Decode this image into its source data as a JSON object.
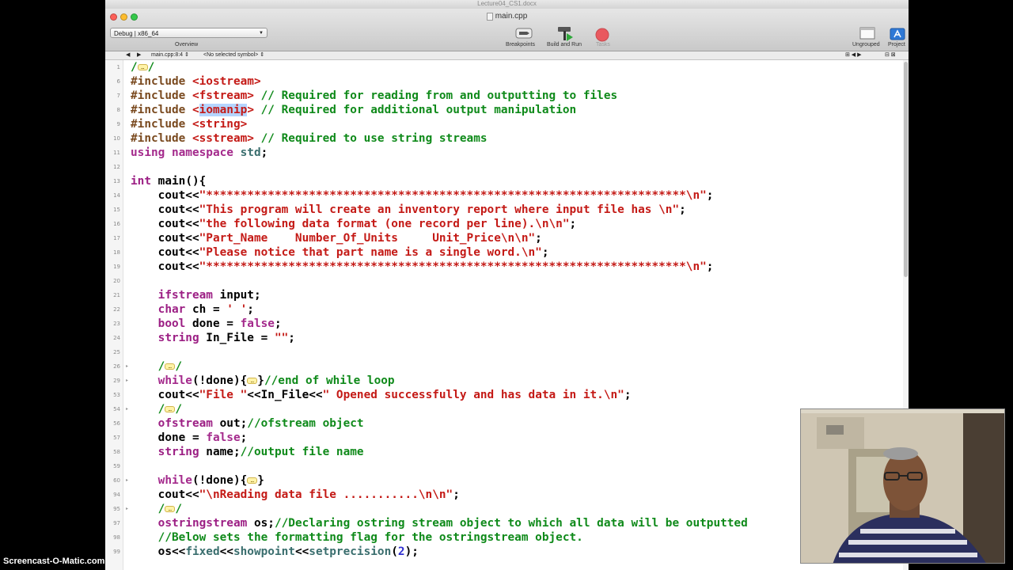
{
  "window": {
    "doc_title": "Lecture04_CS1.docx",
    "file_title": "main.cpp"
  },
  "toolbar": {
    "scheme": "Debug | x86_64",
    "overview": "Overview",
    "breakpoints": "Breakpoints",
    "build_and_run": "Build and Run",
    "tasks": "Tasks",
    "ungrouped": "Ungrouped",
    "project": "Project"
  },
  "jumpbar": {
    "back": "◀",
    "forward": "▶",
    "file": "main.cpp:8:4 ⇕",
    "symbol": "<No selected symbol> ⇕"
  },
  "code": {
    "lines": [
      {
        "n": "1",
        "fold": "",
        "segs": [
          {
            "t": "/",
            "c": "cm"
          },
          {
            "t": "…",
            "c": "fb"
          },
          {
            "t": "/",
            "c": "cm"
          }
        ]
      },
      {
        "n": "6",
        "fold": "",
        "segs": [
          {
            "t": "#include ",
            "c": "pp"
          },
          {
            "t": "<iostream>",
            "c": "str"
          }
        ]
      },
      {
        "n": "7",
        "fold": "",
        "segs": [
          {
            "t": "#include ",
            "c": "pp"
          },
          {
            "t": "<fstream>",
            "c": "str"
          },
          {
            "t": " // Required for reading from and outputting to files",
            "c": "cm"
          }
        ]
      },
      {
        "n": "8",
        "fold": "",
        "segs": [
          {
            "t": "#include ",
            "c": "pp"
          },
          {
            "t": "<",
            "c": "str"
          },
          {
            "t": "iomanip",
            "c": "str hl"
          },
          {
            "t": ">",
            "c": "str"
          },
          {
            "t": " // Required for additional output manipulation",
            "c": "cm"
          }
        ]
      },
      {
        "n": "9",
        "fold": "",
        "segs": [
          {
            "t": "#include ",
            "c": "pp"
          },
          {
            "t": "<string>",
            "c": "str"
          }
        ]
      },
      {
        "n": "10",
        "fold": "",
        "segs": [
          {
            "t": "#include ",
            "c": "pp"
          },
          {
            "t": "<sstream>",
            "c": "str"
          },
          {
            "t": " // Required to use string streams",
            "c": "cm"
          }
        ]
      },
      {
        "n": "11",
        "fold": "",
        "segs": [
          {
            "t": "using namespace ",
            "c": "kw"
          },
          {
            "t": "std",
            "c": "lib"
          },
          {
            "t": ";",
            "c": ""
          }
        ]
      },
      {
        "n": "12",
        "fold": "",
        "segs": []
      },
      {
        "n": "13",
        "fold": "",
        "segs": [
          {
            "t": "int",
            "c": "ty"
          },
          {
            "t": " main(){",
            "c": ""
          }
        ]
      },
      {
        "n": "14",
        "fold": "",
        "segs": [
          {
            "t": "    cout<<",
            "c": ""
          },
          {
            "t": "\"**********************************************************************\\n\"",
            "c": "str"
          },
          {
            "t": ";",
            "c": ""
          }
        ]
      },
      {
        "n": "15",
        "fold": "",
        "segs": [
          {
            "t": "    cout<<",
            "c": ""
          },
          {
            "t": "\"This program will create an inventory report where input file has \\n\"",
            "c": "str"
          },
          {
            "t": ";",
            "c": ""
          }
        ]
      },
      {
        "n": "16",
        "fold": "",
        "segs": [
          {
            "t": "    cout<<",
            "c": ""
          },
          {
            "t": "\"the following data format (one record per line).\\n\\n\"",
            "c": "str"
          },
          {
            "t": ";",
            "c": ""
          }
        ]
      },
      {
        "n": "17",
        "fold": "",
        "segs": [
          {
            "t": "    cout<<",
            "c": ""
          },
          {
            "t": "\"Part_Name    Number_Of_Units     Unit_Price\\n\\n\"",
            "c": "str"
          },
          {
            "t": ";",
            "c": ""
          }
        ]
      },
      {
        "n": "18",
        "fold": "",
        "segs": [
          {
            "t": "    cout<<",
            "c": ""
          },
          {
            "t": "\"Please notice that part name is a single word.\\n\"",
            "c": "str"
          },
          {
            "t": ";",
            "c": ""
          }
        ]
      },
      {
        "n": "19",
        "fold": "",
        "segs": [
          {
            "t": "    cout<<",
            "c": ""
          },
          {
            "t": "\"**********************************************************************\\n\"",
            "c": "str"
          },
          {
            "t": ";",
            "c": ""
          }
        ]
      },
      {
        "n": "20",
        "fold": "",
        "segs": []
      },
      {
        "n": "21",
        "fold": "",
        "segs": [
          {
            "t": "    ifstream",
            "c": "ty"
          },
          {
            "t": " input;",
            "c": ""
          }
        ]
      },
      {
        "n": "22",
        "fold": "",
        "segs": [
          {
            "t": "    char",
            "c": "ty"
          },
          {
            "t": " ch = ",
            "c": ""
          },
          {
            "t": "' '",
            "c": "str"
          },
          {
            "t": ";",
            "c": ""
          }
        ]
      },
      {
        "n": "23",
        "fold": "",
        "segs": [
          {
            "t": "    bool",
            "c": "ty"
          },
          {
            "t": " done = ",
            "c": ""
          },
          {
            "t": "false",
            "c": "kw"
          },
          {
            "t": ";",
            "c": ""
          }
        ]
      },
      {
        "n": "24",
        "fold": "",
        "segs": [
          {
            "t": "    string",
            "c": "ty"
          },
          {
            "t": " In_File = ",
            "c": ""
          },
          {
            "t": "\"\"",
            "c": "str"
          },
          {
            "t": ";",
            "c": ""
          }
        ]
      },
      {
        "n": "25",
        "fold": "",
        "segs": []
      },
      {
        "n": "26",
        "fold": "▸",
        "segs": [
          {
            "t": "    /",
            "c": "cm"
          },
          {
            "t": "…",
            "c": "fb"
          },
          {
            "t": "/",
            "c": "cm"
          }
        ]
      },
      {
        "n": "29",
        "fold": "▸",
        "segs": [
          {
            "t": "    while",
            "c": "kw"
          },
          {
            "t": "(!done){",
            "c": ""
          },
          {
            "t": "…",
            "c": "fb"
          },
          {
            "t": "}",
            "c": ""
          },
          {
            "t": "//end of while loop",
            "c": "cm"
          }
        ]
      },
      {
        "n": "53",
        "fold": "",
        "segs": [
          {
            "t": "    cout<<",
            "c": ""
          },
          {
            "t": "\"File \"",
            "c": "str"
          },
          {
            "t": "<<In_File<<",
            "c": ""
          },
          {
            "t": "\" Opened successfully and has data in it.\\n\"",
            "c": "str"
          },
          {
            "t": ";",
            "c": ""
          }
        ]
      },
      {
        "n": "54",
        "fold": "▸",
        "segs": [
          {
            "t": "    /",
            "c": "cm"
          },
          {
            "t": "…",
            "c": "fb"
          },
          {
            "t": "/",
            "c": "cm"
          }
        ]
      },
      {
        "n": "56",
        "fold": "",
        "segs": [
          {
            "t": "    ofstream",
            "c": "ty"
          },
          {
            "t": " out;",
            "c": ""
          },
          {
            "t": "//ofstream object",
            "c": "cm"
          }
        ]
      },
      {
        "n": "57",
        "fold": "",
        "segs": [
          {
            "t": "    done = ",
            "c": ""
          },
          {
            "t": "false",
            "c": "kw"
          },
          {
            "t": ";",
            "c": ""
          }
        ]
      },
      {
        "n": "58",
        "fold": "",
        "segs": [
          {
            "t": "    string",
            "c": "ty"
          },
          {
            "t": " name;",
            "c": ""
          },
          {
            "t": "//output file name",
            "c": "cm"
          }
        ]
      },
      {
        "n": "59",
        "fold": "",
        "segs": []
      },
      {
        "n": "60",
        "fold": "▸",
        "segs": [
          {
            "t": "    while",
            "c": "kw"
          },
          {
            "t": "(!done){",
            "c": ""
          },
          {
            "t": "…",
            "c": "fb"
          },
          {
            "t": "}",
            "c": ""
          }
        ]
      },
      {
        "n": "94",
        "fold": "",
        "segs": [
          {
            "t": "    cout<<",
            "c": ""
          },
          {
            "t": "\"\\nReading data file ...........\\n\\n\"",
            "c": "str"
          },
          {
            "t": ";",
            "c": ""
          }
        ]
      },
      {
        "n": "95",
        "fold": "▸",
        "segs": [
          {
            "t": "    /",
            "c": "cm"
          },
          {
            "t": "…",
            "c": "fb"
          },
          {
            "t": "/",
            "c": "cm"
          }
        ]
      },
      {
        "n": "97",
        "fold": "",
        "segs": [
          {
            "t": "    ostringstream",
            "c": "ty"
          },
          {
            "t": " os;",
            "c": ""
          },
          {
            "t": "//Declaring ostring stream object to which all data will be outputted",
            "c": "cm"
          }
        ]
      },
      {
        "n": "98",
        "fold": "",
        "segs": [
          {
            "t": "    //Below sets the formatting flag for the ostringstream object.",
            "c": "cm"
          }
        ]
      },
      {
        "n": "99",
        "fold": "",
        "segs": [
          {
            "t": "    os<<",
            "c": ""
          },
          {
            "t": "fixed",
            "c": "lib"
          },
          {
            "t": "<<",
            "c": ""
          },
          {
            "t": "showpoint",
            "c": "lib"
          },
          {
            "t": "<<",
            "c": ""
          },
          {
            "t": "setprecision",
            "c": "lib"
          },
          {
            "t": "(",
            "c": ""
          },
          {
            "t": "2",
            "c": "nm"
          },
          {
            "t": ");",
            "c": ""
          }
        ]
      }
    ]
  },
  "watermark": "Screencast-O-Matic.com"
}
